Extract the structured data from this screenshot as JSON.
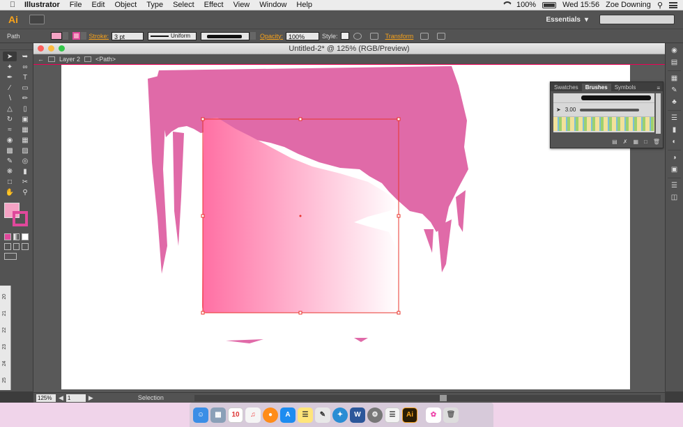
{
  "menubar": {
    "app": "Illustrator",
    "items": [
      "File",
      "Edit",
      "Object",
      "Type",
      "Select",
      "Effect",
      "View",
      "Window",
      "Help"
    ],
    "battery": "100%",
    "clock": "Wed 15:56",
    "user": "Zoe Downing"
  },
  "appbar": {
    "logo": "Ai",
    "workspace": "Essentials"
  },
  "control": {
    "selection_type": "Path",
    "stroke_label": "Stroke:",
    "stroke_value": "3 pt",
    "profile": "Uniform",
    "opacity_label": "Opacity:",
    "opacity_value": "100%",
    "style_label": "Style:",
    "transform": "Transform"
  },
  "document": {
    "title": "Untitled-2* @ 125% (RGB/Preview)",
    "layer": "Layer 2",
    "object": "<Path>"
  },
  "status": {
    "zoom": "125%",
    "artboard": "1",
    "tool": "Selection"
  },
  "brushes_panel": {
    "tabs": [
      "Swatches",
      "Brushes",
      "Symbols"
    ],
    "active_tab": "Brushes",
    "brush_size": "3.00"
  },
  "ruler": {
    "ticks": [
      "20",
      "21",
      "22",
      "23",
      "24",
      "25"
    ]
  },
  "colors": {
    "pink": "#e06aa8",
    "gradient_start": "#ff6fa3",
    "selection": "#e8342c",
    "accent": "#f7a21b"
  },
  "dock": {
    "calendar_day": "10"
  }
}
